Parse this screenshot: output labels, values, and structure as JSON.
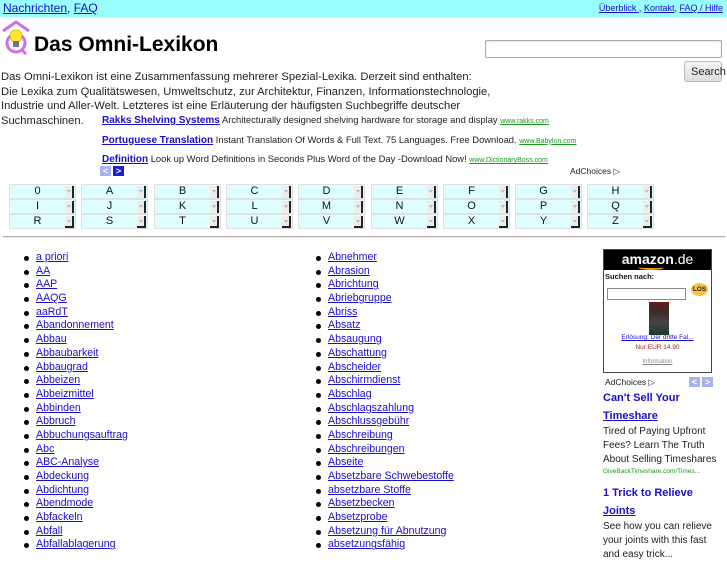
{
  "topbar": {
    "left_links": [
      "Nachrichten",
      "FAQ"
    ],
    "right_links": [
      "Überblick ",
      "Kontakt",
      "FAQ / Hilfe"
    ]
  },
  "header": {
    "title": "Das Omni-Lexikon",
    "search_value": "",
    "search_button": "Search"
  },
  "intro": "Das Omni-Lexikon ist eine Zusammenfassung mehrerer Spezial-Lexika. Derzeit sind enthalten: Die Lexika zum Qualitätswesen, Umweltschutz, zur Architektur, Finanzen, Informationstechnologie, Industrie und Aller-Welt. Letzteres ist eine Erläuterung der häufigsten Suchbegriffe deutscher Suchmaschinen.",
  "text_ads": [
    {
      "title": "Rakks Shelving Systems",
      "desc": "Architecturally designed shelving hardware for storage and display",
      "url": "www.rakks.com"
    },
    {
      "title": "Portuguese Translation",
      "desc": "Instant Translation Of Words & Full Text. 75 Languages. Free Download.",
      "url": "www.Babylon.com"
    },
    {
      "title": "Definition",
      "desc": "Look up Word Definitions in Seconds Plus Word of the Day -Download Now!",
      "url": "www.DictionaryBoss.com"
    }
  ],
  "ad_nav": {
    "prev": "<",
    "next": ">"
  },
  "adchoices": "AdChoices ▷",
  "letters": [
    [
      "0",
      "A",
      "B",
      "C",
      "D",
      "E",
      "F",
      "G",
      "H"
    ],
    [
      "I",
      "J",
      "K",
      "L",
      "M",
      "N",
      "O",
      "P",
      "Q"
    ],
    [
      "R",
      "S",
      "T",
      "U",
      "V",
      "W",
      "X",
      "Y",
      "Z"
    ]
  ],
  "terms_col1": [
    "a priori",
    "AA",
    "AAP",
    "AAQG",
    "aaRdT",
    "Abandonnement",
    "Abbau",
    "Abbaubarkeit",
    "Abbaugrad",
    "Abbeizen",
    "Abbeizmittel",
    "Abbinden",
    "Abbruch",
    "Abbuchungsauftrag",
    "Abc",
    "ABC-Analyse",
    "Abdeckung",
    "Abdichtung",
    "Abendmode",
    "Abfackeln",
    "Abfall",
    "Abfallablagerung"
  ],
  "terms_col2": [
    "Abnehmer",
    "Abrasion",
    "Abrichtung",
    "Abriebgruppe",
    "Abriss",
    "Absatz",
    "Absaugung",
    "Abschattung",
    "Abscheider",
    "Abschirmdienst",
    "Abschlag",
    "Abschlagszahlung",
    "Abschlussgebühr",
    "Abschreibung",
    "Abschreibungen",
    "Abseite",
    "Absetzbare Schwebestoffe",
    "absetzbare Stoffe",
    "Absetzbecken",
    "Absetzprobe",
    "Absetzung für Abnutzung",
    "absetzungsfähig"
  ],
  "amazon": {
    "logo": "amazon",
    "logo_tld": ".de",
    "search_label": "Suchen nach:",
    "search_value": "",
    "go_button": "LOS",
    "product_title": "Erlösung: Der dritte Fal...",
    "price": "Nur EUR 14.90",
    "info": "Information"
  },
  "side_ads": [
    {
      "title_line1": "Can't Sell Your",
      "title_line2": "Timeshare",
      "desc": "Tired of Paying Upfront Fees? Learn The Truth About Selling Timeshares",
      "url": "GiveBackTimeshare.com/Times..."
    },
    {
      "title_line1": "1 Trick to Relieve",
      "title_line2": "Joints",
      "desc": "See how you can relieve your joints with this fast and easy trick...",
      "url": ""
    }
  ]
}
